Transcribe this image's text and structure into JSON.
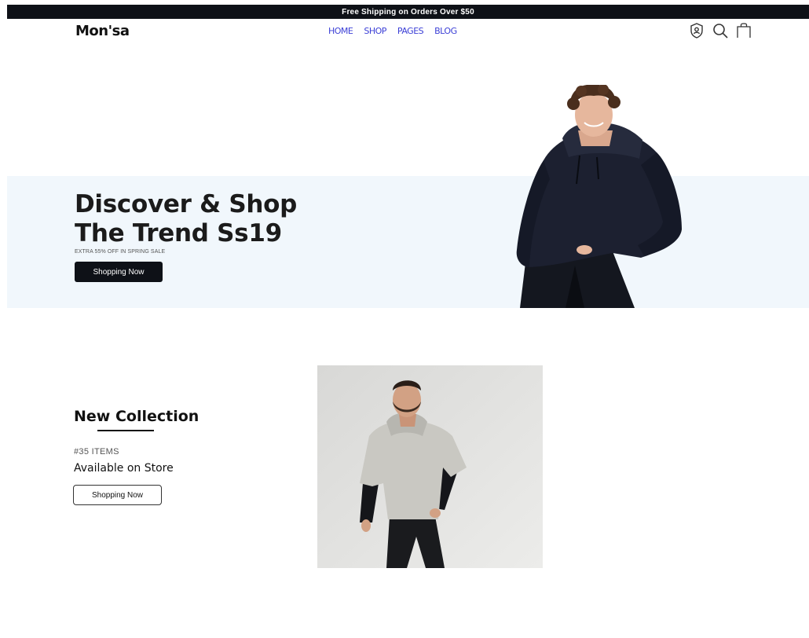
{
  "topbar": {
    "text": "Free Shipping on Orders Over $50"
  },
  "header": {
    "logo": "Mon'sa",
    "nav": [
      "HOME",
      "SHOP",
      "PAGES",
      "BLOG"
    ],
    "icons": [
      "account-shield-icon",
      "search-icon",
      "shopping-bag-icon"
    ]
  },
  "hero": {
    "title_line1": "Discover & Shop",
    "title_line2": "The Trend Ss19",
    "subtitle": "EXTRA 55% OFF IN SPRING SALE",
    "button": "Shopping Now"
  },
  "collection": {
    "title": "New Collection",
    "count": "#35 ITEMS",
    "availability": "Available on Store",
    "button": "Shopping Now"
  },
  "colors": {
    "dark": "#0e1117",
    "hero_band": "#f1f7fc",
    "nav": "#3b3fd6"
  }
}
